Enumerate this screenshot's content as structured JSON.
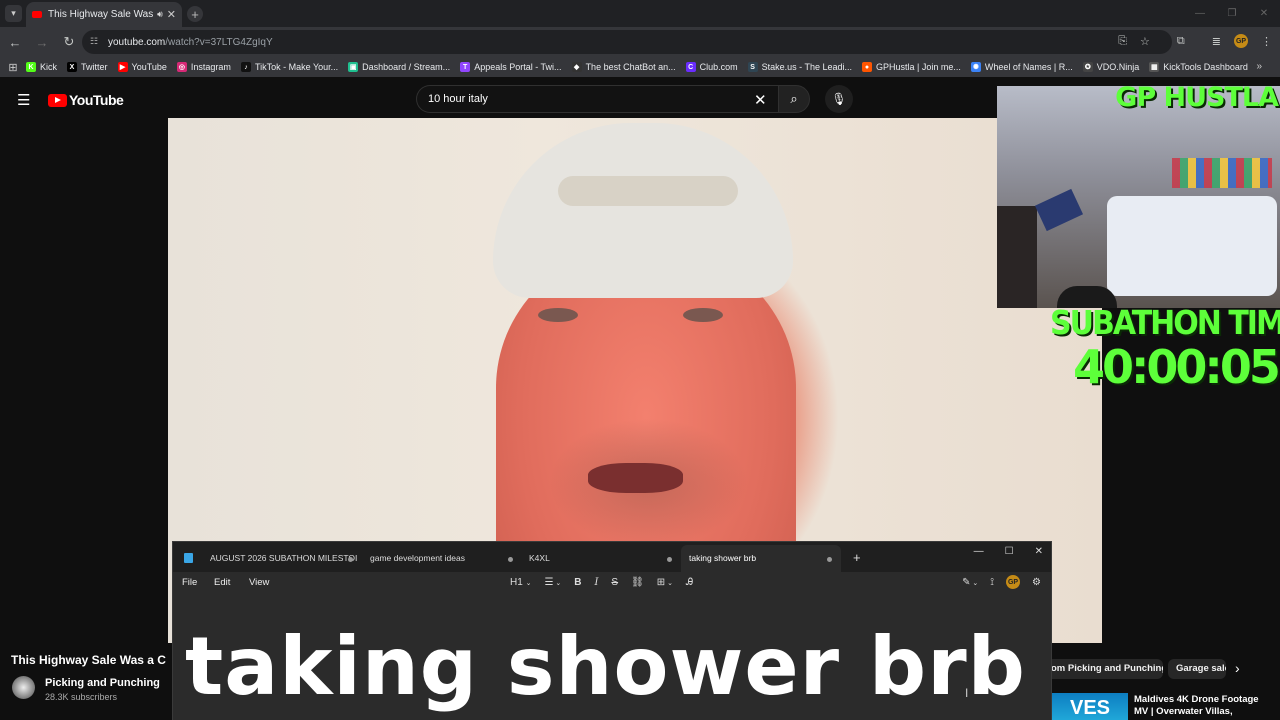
{
  "browser": {
    "tab_title": "This Highway Sale Was a Co",
    "url_host": "youtube.com",
    "url_path": "/watch?v=37LTG4ZgIqY",
    "profile_initials": "GP"
  },
  "bookmarks": [
    {
      "label": "Kick",
      "icon_color": "#53fc18",
      "icon": "K"
    },
    {
      "label": "Twitter",
      "icon_color": "#000000",
      "icon": "X"
    },
    {
      "label": "YouTube",
      "icon_color": "#ff0000",
      "icon": "▶"
    },
    {
      "label": "Instagram",
      "icon_color": "#d62976",
      "icon": "◎"
    },
    {
      "label": "TikTok - Make Your...",
      "icon_color": "#111111",
      "icon": "♪"
    },
    {
      "label": "Dashboard / Stream...",
      "icon_color": "#1fbf8f",
      "icon": "▣"
    },
    {
      "label": "Appeals Portal - Twi...",
      "icon_color": "#9146ff",
      "icon": "T"
    },
    {
      "label": "The best ChatBot an...",
      "icon_color": "#333333",
      "icon": "◆"
    },
    {
      "label": "Club.com",
      "icon_color": "#6a2cff",
      "icon": "C"
    },
    {
      "label": "Stake.us - The Leadi...",
      "icon_color": "#2f4553",
      "icon": "S"
    },
    {
      "label": "GPHustla | Join me...",
      "icon_color": "#ff5500",
      "icon": "●"
    },
    {
      "label": "Wheel of Names | R...",
      "icon_color": "#3b82f6",
      "icon": "✺"
    },
    {
      "label": "VDO.Ninja",
      "icon_color": "#444444",
      "icon": "✪"
    },
    {
      "label": "KickTools Dashboard",
      "icon_color": "#555555",
      "icon": "▦"
    }
  ],
  "youtube": {
    "logo_text": "YouTube",
    "search_value": "10 hour italy",
    "video_title": "This Highway Sale Was a C",
    "channel_name": "Picking and Punching",
    "channel_subs": "28.3K subscribers",
    "chips": [
      "om Picking and Punching",
      "Garage sale"
    ],
    "rec_thumb_text": "VES",
    "rec_title": "Maldives 4K Drone Footage MV | Overwater Villas,"
  },
  "overlay": {
    "streamer_name": "GP HUSTLA",
    "timer_label": "SUBATHON TIMER",
    "timer_value": "40:00:05",
    "accent_color": "#5dff3a"
  },
  "notepad": {
    "tabs": [
      "AUGUST 2026 SUBATHON MILESTOI",
      "game development ideas",
      "K4XL",
      "taking shower brb"
    ],
    "active_tab": "taking shower brb",
    "menu": [
      "File",
      "Edit",
      "View"
    ],
    "heading_label": "H1",
    "content": "taking shower brb",
    "profile_initials": "GP"
  }
}
